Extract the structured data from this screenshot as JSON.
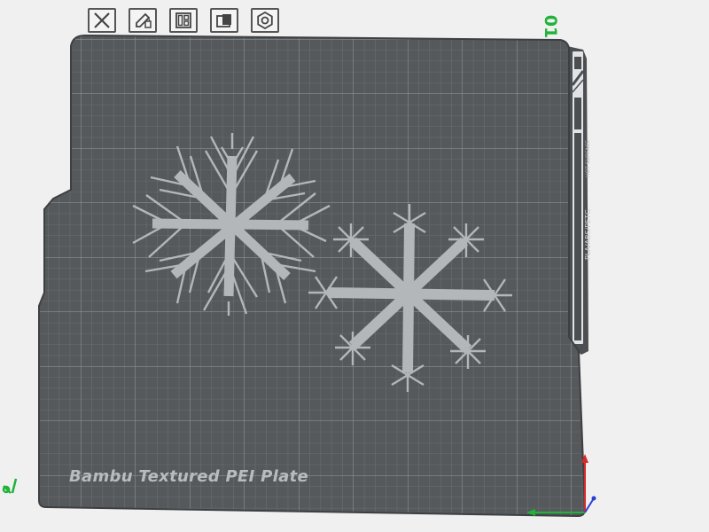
{
  "plate": {
    "label": "Bambu Textured PEI Plate",
    "number": "01",
    "filament_tag": "PLA/ABS/PETG",
    "surface_tag": "HOT SURFACE",
    "colors": {
      "background": "#f0f0f0",
      "plate": "#5a5d60",
      "grid": "#8a8d90",
      "model": "#b4b7ba",
      "plate_number": "#1fb33a",
      "axis_x": "#1fb33a",
      "axis_y": "#d42a2a",
      "axis_z": "#2a3fd4"
    }
  },
  "toolbar": [
    {
      "name": "delete-plate-button",
      "icon": "close-icon"
    },
    {
      "name": "lock-plate-button",
      "icon": "pencil-lock-icon"
    },
    {
      "name": "arrange-plate-button",
      "icon": "arrange-icon"
    },
    {
      "name": "orient-plate-button",
      "icon": "orient-icon"
    },
    {
      "name": "plate-settings-button",
      "icon": "gear-icon"
    }
  ],
  "models": [
    {
      "name": "snowflake-left",
      "type": "fern"
    },
    {
      "name": "snowflake-right",
      "type": "star"
    }
  ]
}
